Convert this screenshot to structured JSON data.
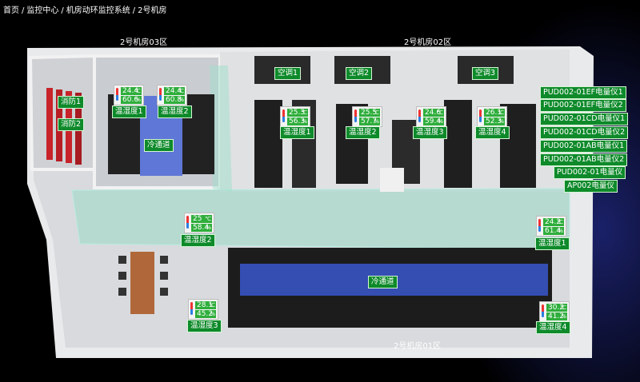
{
  "breadcrumb": [
    "首页",
    "监控中心",
    "机房动环监控系统",
    "2号机房"
  ],
  "zones": {
    "zone03": "2号机房03区",
    "zone02": "2号机房02区",
    "zone01": "2号机房01区"
  },
  "labels": {
    "fire1": "消防1",
    "fire2": "消防2",
    "cold_aisle_left": "冷通道",
    "cold_aisle_main": "冷通道",
    "ac1": "空调1",
    "ac2": "空调2",
    "ac3": "空调3"
  },
  "meters": [
    "PUD002-01EF电量仪1",
    "PUD002-01EF电量仪2",
    "PUD002-01CD电量仪1",
    "PUD002-01CD电量仪2",
    "PUD002-01AB电量仪1",
    "PUD002-01AB电量仪2",
    "PUD002-01电量仪",
    "AP002电量仪"
  ],
  "sensors": {
    "z03_1": {
      "label": "温湿度1",
      "temp": "24.4",
      "hum": "60.6"
    },
    "z03_2": {
      "label": "温湿度2",
      "temp": "24.4",
      "hum": "60.8"
    },
    "z02_1": {
      "label": "温湿度1",
      "temp": "25.3",
      "hum": "56.3"
    },
    "z02_2": {
      "label": "温湿度2",
      "temp": "25.5",
      "hum": "57.7"
    },
    "z02_3": {
      "label": "温湿度3",
      "temp": "24.6",
      "hum": "59.4"
    },
    "z02_4": {
      "label": "温湿度4",
      "temp": "26.1",
      "hum": "52.3"
    },
    "z01_1": {
      "label": "温湿度1",
      "temp": "24.2",
      "hum": "61.4"
    },
    "z01_2": {
      "label": "温湿度2",
      "temp": "25",
      "hum": "58.4"
    },
    "z01_3": {
      "label": "温湿度3",
      "temp": "28.1",
      "hum": "45.2"
    },
    "z01_4": {
      "label": "温湿度4",
      "temp": "30.2",
      "hum": "41.2"
    }
  },
  "colors": {
    "tag_green": "#0e8a2a",
    "reading_green": "#2fae3c",
    "cold_aisle_blue": "#3b5bd8"
  }
}
